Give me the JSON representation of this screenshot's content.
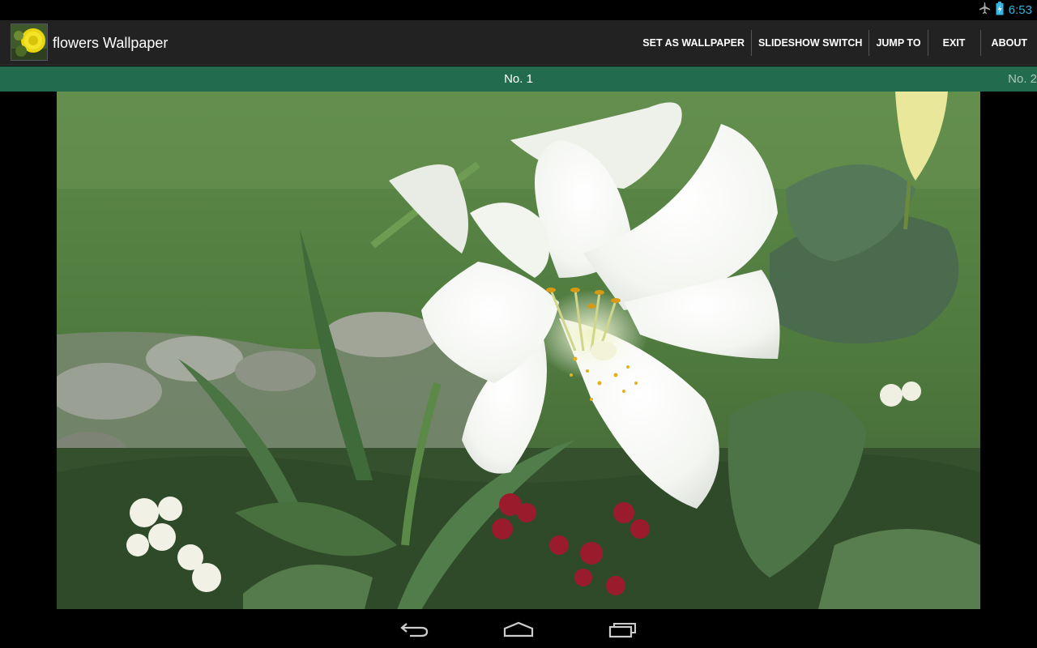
{
  "status_bar": {
    "time": "6:53",
    "icons": [
      "airplane-mode-icon",
      "battery-charging-icon"
    ]
  },
  "action_bar": {
    "app_title": "flowers Wallpaper",
    "app_icon": "sunflower-thumbnail-icon",
    "actions": {
      "set_wallpaper": "SET AS WALLPAPER",
      "slideshow": "SLIDESHOW SWITCH",
      "jump_to": "JUMP TO",
      "exit": "EXIT",
      "about": "ABOUT"
    }
  },
  "pager": {
    "current": "No. 1",
    "next": "No. 2",
    "accent": "#236b4f"
  },
  "photo": {
    "subject": "white-lily-photo"
  },
  "nav_bar": {
    "buttons": [
      "back-icon",
      "home-icon",
      "recent-apps-icon"
    ]
  }
}
